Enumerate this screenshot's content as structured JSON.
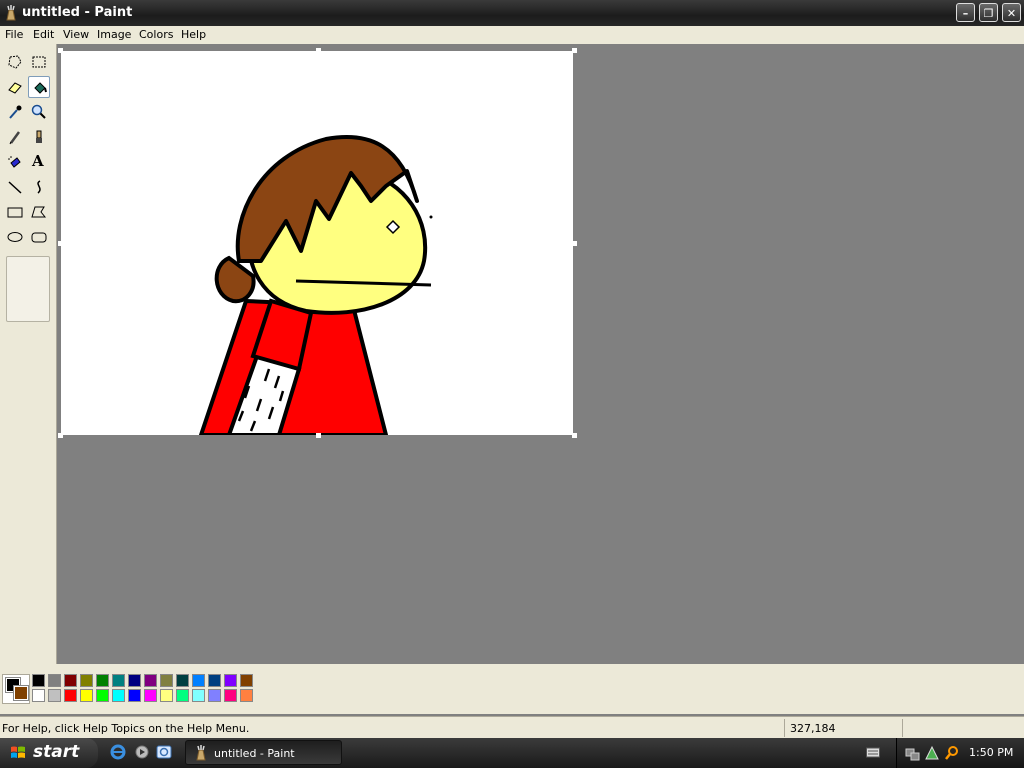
{
  "window": {
    "title": "untitled - Paint",
    "app_icon": "paint-icon"
  },
  "window_controls": {
    "minimize": "–",
    "restore": "❐",
    "close": "✕"
  },
  "menu": [
    "File",
    "Edit",
    "View",
    "Image",
    "Colors",
    "Help"
  ],
  "tools": [
    {
      "name": "free-form-select-tool",
      "icon": "free-form-select-icon"
    },
    {
      "name": "select-tool",
      "icon": "rect-select-icon"
    },
    {
      "name": "eraser-tool",
      "icon": "eraser-icon"
    },
    {
      "name": "fill-tool",
      "icon": "paint-bucket-icon",
      "active": true
    },
    {
      "name": "pick-color-tool",
      "icon": "eyedropper-icon"
    },
    {
      "name": "magnifier-tool",
      "icon": "magnifier-icon"
    },
    {
      "name": "pencil-tool",
      "icon": "pencil-icon"
    },
    {
      "name": "brush-tool",
      "icon": "brush-icon"
    },
    {
      "name": "airbrush-tool",
      "icon": "airbrush-icon"
    },
    {
      "name": "text-tool",
      "icon": "text-icon",
      "glyph": "A"
    },
    {
      "name": "line-tool",
      "icon": "line-icon"
    },
    {
      "name": "curve-tool",
      "icon": "curve-icon"
    },
    {
      "name": "rectangle-tool",
      "icon": "rectangle-icon"
    },
    {
      "name": "polygon-tool",
      "icon": "polygon-icon"
    },
    {
      "name": "ellipse-tool",
      "icon": "ellipse-icon"
    },
    {
      "name": "rounded-rectangle-tool",
      "icon": "rounded-rect-icon"
    }
  ],
  "palette": {
    "foreground": "#000000",
    "background": "#804000",
    "row1": [
      "#000000",
      "#808080",
      "#800000",
      "#808000",
      "#008000",
      "#008080",
      "#000080",
      "#800080",
      "#808040",
      "#004040",
      "#0080ff",
      "#004080",
      "#8000ff",
      "#804000"
    ],
    "row2": [
      "#ffffff",
      "#c0c0c0",
      "#ff0000",
      "#ffff00",
      "#00ff00",
      "#00ffff",
      "#0000ff",
      "#ff00ff",
      "#ffff80",
      "#00ff80",
      "#80ffff",
      "#8080ff",
      "#ff0080",
      "#ff8040"
    ]
  },
  "status": {
    "help_text": "For Help, click Help Topics on the Help Menu.",
    "coords": "327,184"
  },
  "taskbar": {
    "start_label": "start",
    "task_label": "untitled - Paint",
    "clock": "1:50 PM",
    "quick_launch": [
      "internet-explorer-icon",
      "media-icon",
      "ie-browser-icon"
    ]
  },
  "drawing": {
    "hair_color": "#8b4513",
    "skin_color": "#ffff80",
    "clothes_color": "#ff0000"
  }
}
